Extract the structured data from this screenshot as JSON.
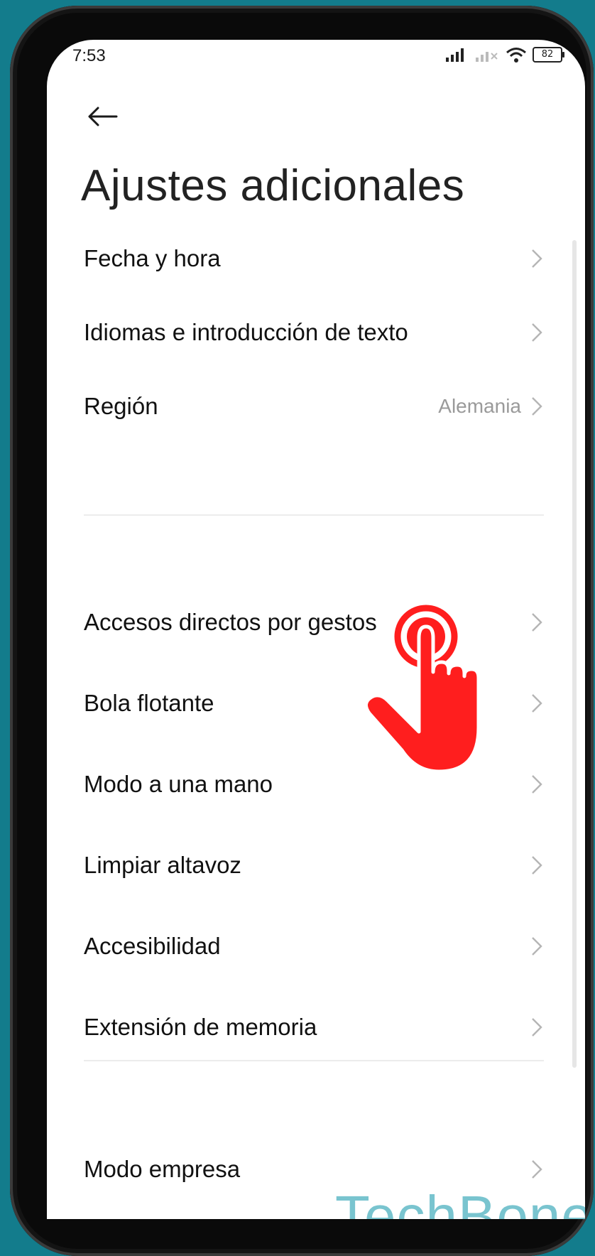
{
  "status_bar": {
    "time": "7:53",
    "battery": "82"
  },
  "header": {
    "title": "Ajustes adicionales"
  },
  "group_1": [
    {
      "label": "Fecha y hora",
      "value": ""
    },
    {
      "label": "Idiomas e introducción de texto",
      "value": ""
    },
    {
      "label": "Región",
      "value": "Alemania"
    }
  ],
  "group_2": [
    {
      "label": "Accesos directos por gestos"
    },
    {
      "label": "Bola flotante"
    },
    {
      "label": "Modo a una mano"
    },
    {
      "label": "Limpiar altavoz"
    },
    {
      "label": "Accesibilidad"
    },
    {
      "label": "Extensión de memoria"
    }
  ],
  "group_3": [
    {
      "label": "Modo empresa"
    }
  ],
  "watermark": "TechBone",
  "colors": {
    "background": "#137c8c",
    "tap_indicator": "#ff1e1e",
    "watermark": "#79c4cf"
  },
  "icons": [
    "back-arrow-icon",
    "chevron-right-icon",
    "tap-hand-icon",
    "signal-icon",
    "wifi-icon",
    "battery-icon"
  ]
}
